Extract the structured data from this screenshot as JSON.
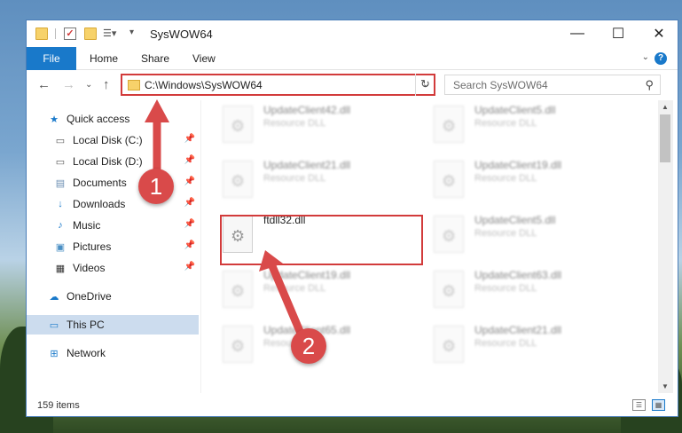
{
  "window": {
    "title": "SysWOW64",
    "minimize": "—",
    "maximize": "☐",
    "close": "✕"
  },
  "ribbon": {
    "file": "File",
    "tabs": [
      "Home",
      "Share",
      "View"
    ],
    "help": "?"
  },
  "address": {
    "path": "C:\\Windows\\SysWOW64",
    "search_placeholder": "Search SysWOW64"
  },
  "sidebar": {
    "items": [
      {
        "label": "Quick access",
        "icon": "star-icon",
        "pinned": false
      },
      {
        "label": "Local Disk (C:)",
        "icon": "disk-icon",
        "pinned": true
      },
      {
        "label": "Local Disk (D:)",
        "icon": "disk-icon",
        "pinned": true
      },
      {
        "label": "Documents",
        "icon": "documents-icon",
        "pinned": true
      },
      {
        "label": "Downloads",
        "icon": "downloads-icon",
        "pinned": true
      },
      {
        "label": "Music",
        "icon": "music-icon",
        "pinned": true
      },
      {
        "label": "Pictures",
        "icon": "pictures-icon",
        "pinned": true
      },
      {
        "label": "Videos",
        "icon": "videos-icon",
        "pinned": true
      },
      {
        "label": "OneDrive",
        "icon": "cloud-icon",
        "pinned": false
      },
      {
        "label": "This PC",
        "icon": "pc-icon",
        "pinned": false,
        "selected": true
      },
      {
        "label": "Network",
        "icon": "network-icon",
        "pinned": false
      }
    ]
  },
  "files": [
    {
      "name": "UpdateClient42.dll",
      "type": "Resource DLL"
    },
    {
      "name": "UpdateClient5.dll",
      "type": "Resource DLL"
    },
    {
      "name": "UpdateClient21.dll",
      "type": "Resource DLL"
    },
    {
      "name": "UpdateClient19.dll",
      "type": "Resource DLL"
    },
    {
      "name": "ftdll32.dll",
      "type": ""
    },
    {
      "name": "UpdateClient5.dll",
      "type": "Resource DLL"
    },
    {
      "name": "UpdateClient19.dll",
      "type": "Resource DLL"
    },
    {
      "name": "UpdateClient63.dll",
      "type": "Resource DLL"
    },
    {
      "name": "UpdateClient65.dll",
      "type": "Resource DLL"
    },
    {
      "name": "UpdateClient21.dll",
      "type": "Resource DLL"
    }
  ],
  "status": {
    "count": "159 items"
  },
  "annotations": {
    "step1": "1",
    "step2": "2",
    "accent": "#d94a4a"
  }
}
